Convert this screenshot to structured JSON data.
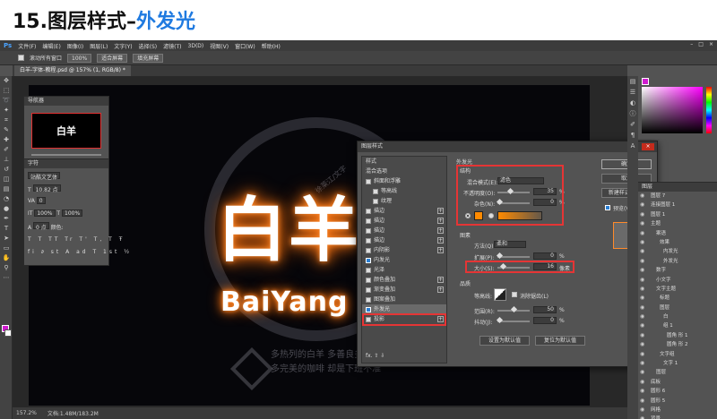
{
  "slide": {
    "title_prefix": "15.图层样式–",
    "title_highlight": "外发光"
  },
  "ps": {
    "app_logo": "Ps",
    "menu": [
      "文件(F)",
      "编辑(E)",
      "图像(I)",
      "图层(L)",
      "文字(Y)",
      "选择(S)",
      "滤镜(T)",
      "3D(D)",
      "视图(V)",
      "窗口(W)",
      "帮助(H)"
    ],
    "options": {
      "scroll_all_label": "滚动所有窗口",
      "zoom_value": "100%",
      "fit_screen": "适合屏幕",
      "fill_screen": "填充屏幕"
    },
    "doc_tab": "白羊-字体-教程.psd @ 157% (1, RGB/8) *",
    "canvas": {
      "main_text": "白羊",
      "sub_text": "BaiYang",
      "wm_line1": "多热列的白羊 多善良多接受",
      "wm_line2": "多完美的咖啡 却是下班不准",
      "wm_side": "徐莱江/文字"
    },
    "status": {
      "zoom": "157.2%",
      "doc_info": "文档:1.48M/183.2M"
    },
    "navigator": {
      "title": "导航器",
      "thumb_text": "白羊"
    },
    "character": {
      "title": "字符",
      "font": "站酷文艺体",
      "size": "10.82 点",
      "tracking": "0",
      "scale_v": "100%",
      "scale_h": "100%",
      "baseline": "0 点",
      "color_label": "颜色:"
    },
    "dialog": {
      "title": "图层样式",
      "close": "×",
      "list_header": "样式",
      "items": [
        {
          "label": "混合选项",
          "checked": null,
          "plus": false
        },
        {
          "label": "斜面和浮雕",
          "checked": false,
          "plus": false
        },
        {
          "label": "等高线",
          "checked": false,
          "plus": false
        },
        {
          "label": "纹理",
          "checked": false,
          "plus": false
        },
        {
          "label": "描边",
          "checked": false,
          "plus": true
        },
        {
          "label": "描边",
          "checked": false,
          "plus": true
        },
        {
          "label": "描边",
          "checked": false,
          "plus": true
        },
        {
          "label": "描边",
          "checked": false,
          "plus": true
        },
        {
          "label": "内阴影",
          "checked": false,
          "plus": true
        },
        {
          "label": "内发光",
          "checked": true,
          "plus": false
        },
        {
          "label": "光泽",
          "checked": false,
          "plus": false
        },
        {
          "label": "颜色叠加",
          "checked": false,
          "plus": true
        },
        {
          "label": "渐变叠加",
          "checked": false,
          "plus": true
        },
        {
          "label": "图案叠加",
          "checked": false,
          "plus": false
        },
        {
          "label": "外发光",
          "checked": true,
          "plus": false
        },
        {
          "label": "投影",
          "checked": false,
          "plus": true
        }
      ],
      "footer_icons": "fx. ⇧ ⇩",
      "section_outer": "外发光",
      "struct_label": "结构",
      "blend_mode_label": "混合模式(E):",
      "blend_mode_value": "滤色",
      "opacity_label": "不透明度(O):",
      "opacity_value": "35",
      "noise_label": "杂色(N):",
      "noise_value": "0",
      "pct": "%",
      "elements_label": "图素",
      "method_label": "方法(Q):",
      "method_value": "柔和",
      "spread_label": "扩展(P):",
      "spread_value": "0",
      "size_label": "大小(S):",
      "size_value": "16",
      "px": "像素",
      "quality_label": "品质",
      "contour_label": "等高线:",
      "antialias_label": "消除锯齿(L)",
      "range_label": "范围(R):",
      "range_value": "50",
      "jitter_label": "抖动(J):",
      "jitter_value": "0",
      "set_default": "设置为默认值",
      "reset_default": "复位为默认值",
      "ok": "确定",
      "cancel": "取消",
      "new_style": "新建样式(W)...",
      "preview": "预览(V)"
    },
    "layers": {
      "title": "图层",
      "rows": [
        "图层 7",
        "连接图层 1",
        "图层 1",
        "主题",
        "案语",
        "效果",
        "内发光",
        "外发光",
        "数字",
        "小文字",
        "文字主题",
        "标题",
        "图层",
        "白",
        "组 1",
        "圆角 形 1",
        "圆角 形 2",
        "文字组",
        "文字 1",
        "图层",
        "底板",
        "圆形 6",
        "圆形 5",
        "网格",
        "背景"
      ]
    },
    "colors": {
      "accent": "#1f7ae0",
      "highlight_box": "#e53535",
      "glow": "#ff8a00",
      "foreground": "#d01bd0"
    }
  }
}
